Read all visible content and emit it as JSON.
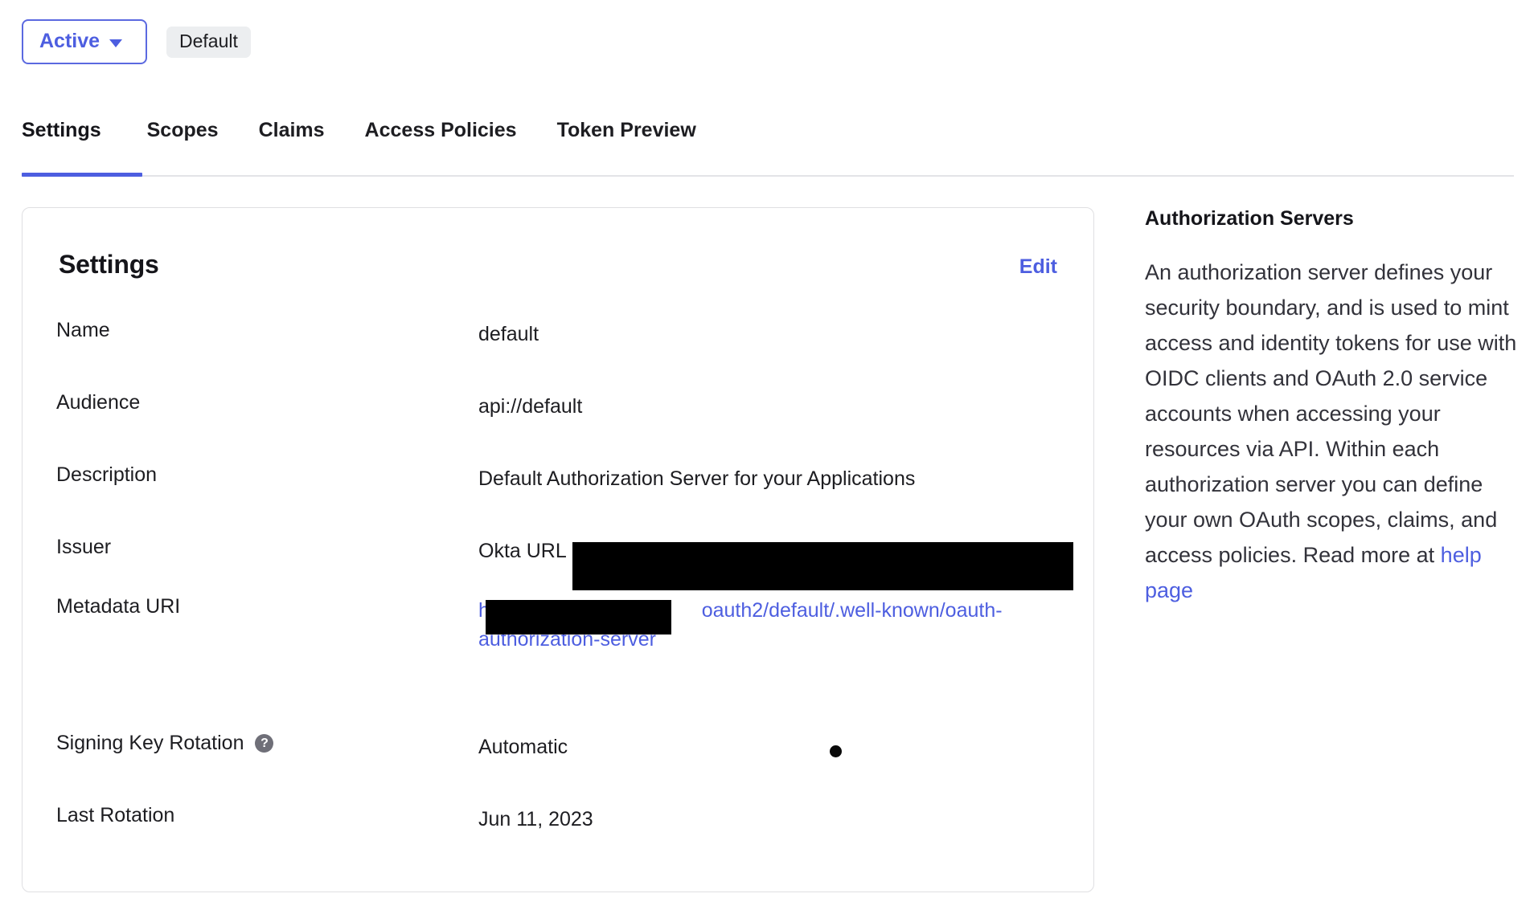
{
  "status_bar": {
    "status_label": "Active",
    "status_caret_icon": "chevron-down-icon",
    "default_badge": "Default"
  },
  "tabs": [
    {
      "label": "Settings",
      "active": true
    },
    {
      "label": "Scopes",
      "active": false
    },
    {
      "label": "Claims",
      "active": false
    },
    {
      "label": "Access Policies",
      "active": false
    },
    {
      "label": "Token Preview",
      "active": false
    }
  ],
  "settings_card": {
    "title": "Settings",
    "edit_label": "Edit",
    "rows": [
      {
        "label": "Name",
        "value": "default"
      },
      {
        "label": "Audience",
        "value": "api://default"
      },
      {
        "label": "Description",
        "value": "Default Authorization Server for your Applications"
      },
      {
        "label": "Issuer",
        "value": "Okta URL",
        "redacted": true
      },
      {
        "label": "Metadata URI",
        "value_prefix": "http",
        "value_suffix": "oauth2/default/.well-known/oauth-authorization-server",
        "is_link": true,
        "redacted": true
      },
      {
        "label": "Signing Key Rotation",
        "value": "Automatic",
        "help_icon": "question-mark-icon"
      },
      {
        "label": "Last Rotation",
        "value": "Jun 11, 2023"
      }
    ]
  },
  "info_panel": {
    "title": "Authorization Servers",
    "body_before_link": "An authorization server defines your security boundary, and is used to mint access and identity tokens for use with OIDC clients and OAuth 2.0 service accounts when accessing your resources via API. Within each authorization server you can define your own OAuth scopes, claims, and access policies. Read more at ",
    "link_label": "help page"
  },
  "colors": {
    "accent_blue": "#4d5ee0",
    "badge_background": "#eceef0",
    "card_border": "#dfdfe2",
    "text_primary": "#1d1d21",
    "redaction_black": "#000000"
  }
}
